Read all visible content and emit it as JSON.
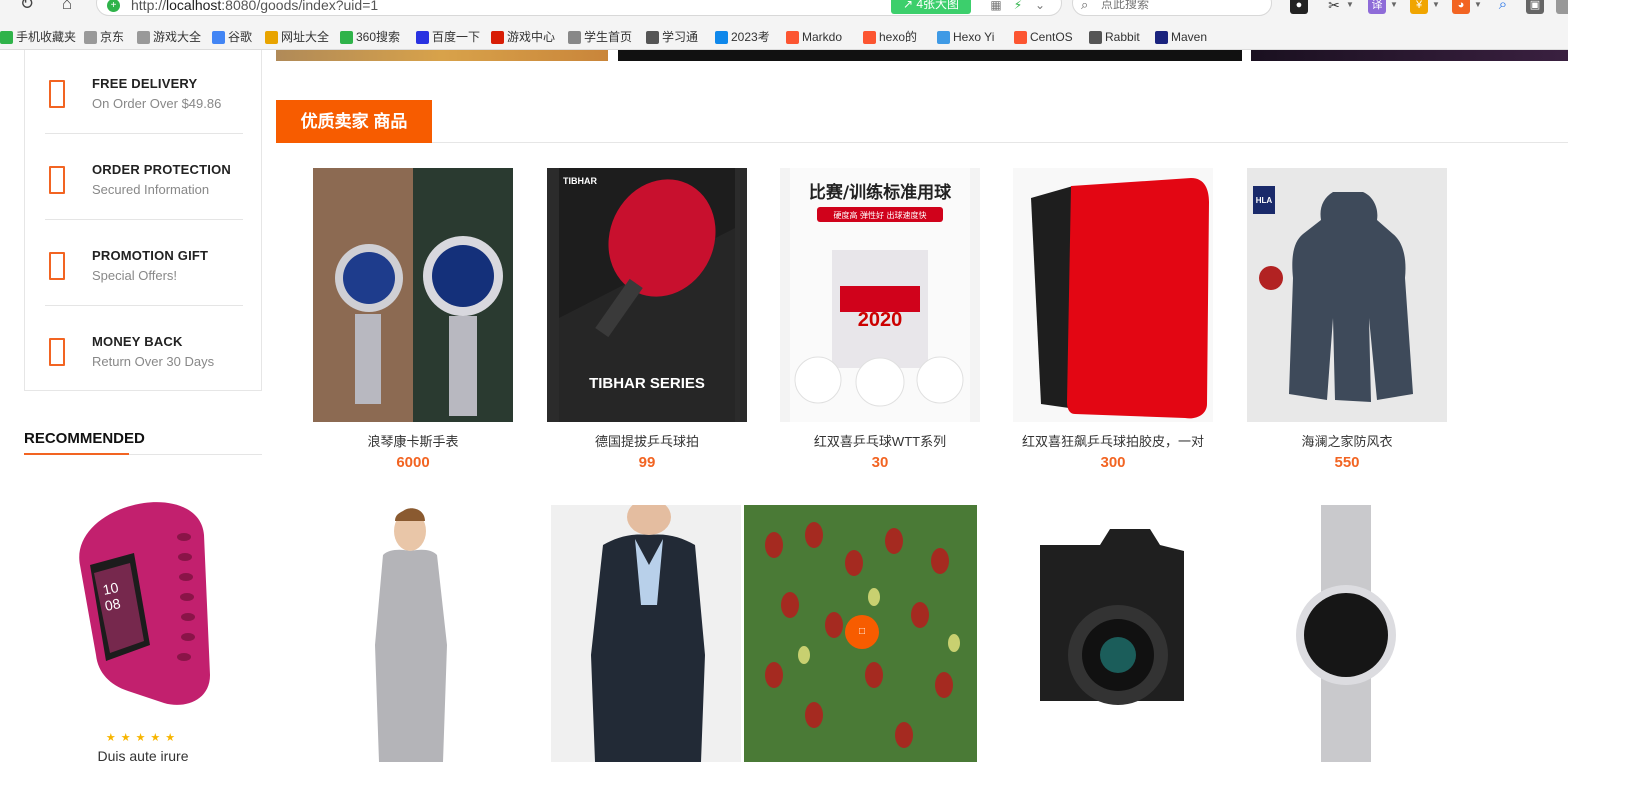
{
  "browser": {
    "url_prefix": "http://",
    "url_host": "localhost",
    "url_rest": ":8080/goods/index?uid=1",
    "big_image_label": "4张大图",
    "search_placeholder": "点此搜索",
    "bookmarks": [
      {
        "label": "手机收藏夹",
        "icon": "bookmark-icon",
        "color": "#2fb34a"
      },
      {
        "label": "京东",
        "icon": "page-icon",
        "color": "#999999"
      },
      {
        "label": "游戏大全",
        "icon": "page-icon",
        "color": "#999999"
      },
      {
        "label": "谷歌",
        "icon": "google-icon",
        "color": "#4285f4"
      },
      {
        "label": "网址大全",
        "icon": "globe-icon",
        "color": "#e8a400"
      },
      {
        "label": "360搜索",
        "icon": "search-360-icon",
        "color": "#2fb34a"
      },
      {
        "label": "百度一下",
        "icon": "baidu-icon",
        "color": "#2932e1"
      },
      {
        "label": "游戏中心",
        "icon": "game-icon",
        "color": "#d81e06"
      },
      {
        "label": "学生首页",
        "icon": "chart-icon",
        "color": "#888888"
      },
      {
        "label": "学习通",
        "icon": "globe-icon",
        "color": "#555555"
      },
      {
        "label": "2023考",
        "icon": "zhihu-icon",
        "color": "#0f88eb"
      },
      {
        "label": "Markdo",
        "icon": "csdn-icon",
        "color": "#fc5531"
      },
      {
        "label": "hexo的",
        "icon": "csdn-icon",
        "color": "#fc5531"
      },
      {
        "label": "Hexo Yi",
        "icon": "hexo-icon",
        "color": "#3f9ae5"
      },
      {
        "label": "CentOS",
        "icon": "csdn-icon",
        "color": "#fc5531"
      },
      {
        "label": "Rabbit",
        "icon": "rabbit-icon",
        "color": "#555555"
      },
      {
        "label": "Maven",
        "icon": "maven-icon",
        "color": "#1a237e"
      }
    ]
  },
  "features": [
    {
      "title": "FREE DELIVERY",
      "subtitle": "On Order Over $49.86",
      "icon": "delivery-icon"
    },
    {
      "title": "ORDER PROTECTION",
      "subtitle": "Secured Information",
      "icon": "protection-icon"
    },
    {
      "title": "PROMOTION GIFT",
      "subtitle": "Special Offers!",
      "icon": "gift-icon"
    },
    {
      "title": "MONEY BACK",
      "subtitle": "Return Over 30 Days",
      "icon": "money-back-icon"
    }
  ],
  "recommended": {
    "title": "RECOMMENDED",
    "item_name": "Duis aute irure",
    "rating": 5,
    "star_glyphs": "★★★★★"
  },
  "section": {
    "title": "优质卖家 商品"
  },
  "products": [
    {
      "name": "浪琴康卡斯手表",
      "price": "6000",
      "image": "watch-image"
    },
    {
      "name": "德国提拔乒乓球拍",
      "price": "99",
      "image": "paddle-image"
    },
    {
      "name": "红双喜乒乓球WTT系列",
      "price": "30",
      "image": "ping-pong-balls-image"
    },
    {
      "name": "红双喜狂飙乒乓球拍胶皮，一对",
      "price": "300",
      "image": "rubber-sheets-image"
    },
    {
      "name": "海澜之家防风衣",
      "price": "550",
      "image": "jacket-image"
    }
  ],
  "product_image_text": {
    "paddle_brand": "TIBHAR",
    "paddle_series": "TIBHAR SERIES",
    "balls_heading": "比赛/训练标准用球",
    "balls_tagline": "硬度高  弹性好  出球速度快",
    "balls_year": "2020",
    "jacket_brand": "HLA"
  },
  "colors": {
    "accent": "#f75c00",
    "price": "#f26422",
    "star": "#f7b500"
  }
}
